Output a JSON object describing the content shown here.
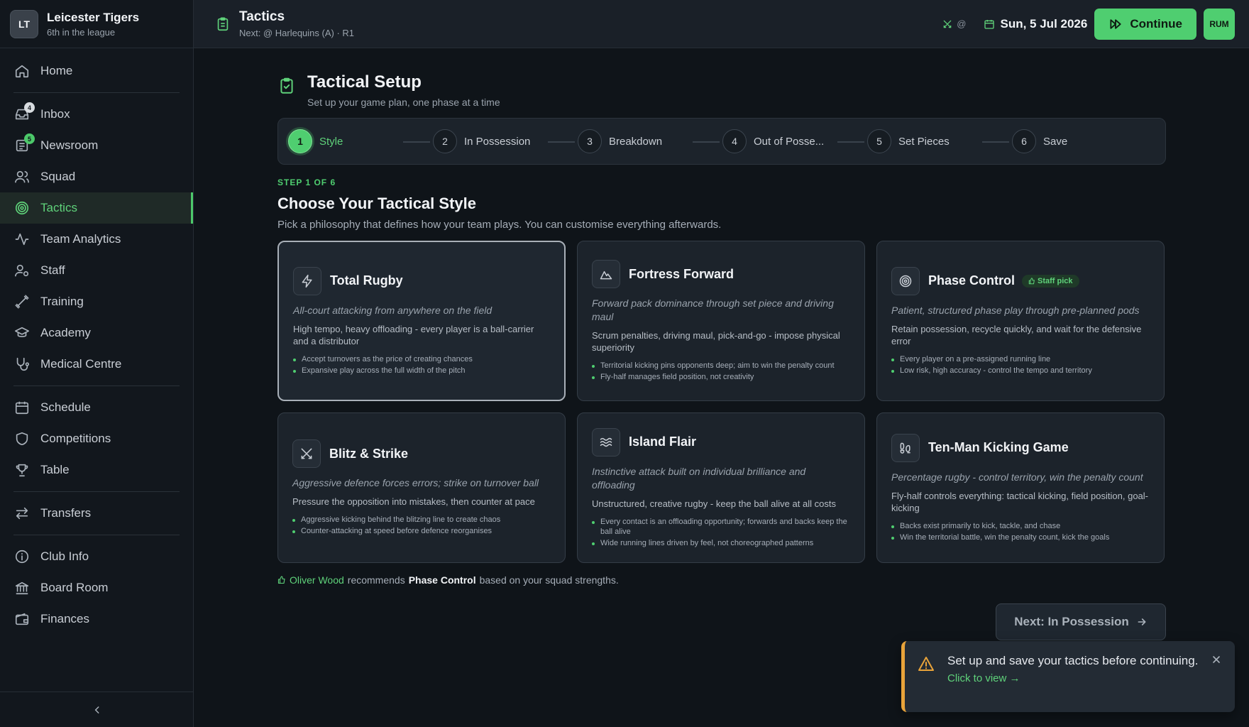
{
  "club": {
    "initials": "LT",
    "name": "Leicester Tigers",
    "position": "6th in the league"
  },
  "sidebar": {
    "items": [
      {
        "label": "Home",
        "icon": "home-icon"
      },
      {
        "label": "Inbox",
        "icon": "inbox-icon",
        "badge": "4"
      },
      {
        "label": "Newsroom",
        "icon": "newspaper-icon",
        "badge": "5"
      },
      {
        "label": "Squad",
        "icon": "users-icon"
      },
      {
        "label": "Tactics",
        "icon": "target-icon",
        "active": true
      },
      {
        "label": "Team Analytics",
        "icon": "activity-icon"
      },
      {
        "label": "Staff",
        "icon": "user-cog-icon"
      },
      {
        "label": "Training",
        "icon": "dumbbell-icon"
      },
      {
        "label": "Academy",
        "icon": "graduation-cap-icon"
      },
      {
        "label": "Medical Centre",
        "icon": "stethoscope-icon"
      },
      {
        "label": "Schedule",
        "icon": "calendar-icon"
      },
      {
        "label": "Competitions",
        "icon": "shield-icon"
      },
      {
        "label": "Table",
        "icon": "trophy-icon"
      },
      {
        "label": "Transfers",
        "icon": "arrows-icon"
      },
      {
        "label": "Club Info",
        "icon": "info-icon"
      },
      {
        "label": "Board Room",
        "icon": "bank-icon"
      },
      {
        "label": "Finances",
        "icon": "wallet-icon"
      }
    ]
  },
  "topbar": {
    "title": "Tactics",
    "subtitle": "Next: @ Harlequins (A) · R1",
    "status_at": "@",
    "date": "Sun, 5 Jul 2026",
    "continue_label": "Continue",
    "user_initials": "RUM"
  },
  "header": {
    "title": "Tactical Setup",
    "subtitle": "Set up your game plan, one phase at a time"
  },
  "steps": [
    {
      "num": "1",
      "label": "Style"
    },
    {
      "num": "2",
      "label": "In Possession"
    },
    {
      "num": "3",
      "label": "Breakdown"
    },
    {
      "num": "4",
      "label": "Out of Posse..."
    },
    {
      "num": "5",
      "label": "Set Pieces"
    },
    {
      "num": "6",
      "label": "Save"
    }
  ],
  "section": {
    "step_of": "STEP 1 OF 6",
    "title": "Choose Your Tactical Style",
    "subtitle": "Pick a philosophy that defines how your team plays. You can customise everything afterwards."
  },
  "styles": [
    {
      "title": "Total Rugby",
      "icon": "lightning-icon",
      "tagline": "All-court attacking from anywhere on the field",
      "description": "High tempo, heavy offloading - every player is a ball-carrier and a distributor",
      "points": [
        "Accept turnovers as the price of creating chances",
        "Expansive play across the full width of the pitch"
      ]
    },
    {
      "title": "Fortress Forward",
      "icon": "mountain-icon",
      "tagline": "Forward pack dominance through set piece and driving maul",
      "description": "Scrum penalties, driving maul, pick-and-go - impose physical superiority",
      "points": [
        "Territorial kicking pins opponents deep; aim to win the penalty count",
        "Fly-half manages field position, not creativity"
      ]
    },
    {
      "title": "Phase Control",
      "icon": "target-icon",
      "badge": "Staff pick",
      "tagline": "Patient, structured phase play through pre-planned pods",
      "description": "Retain possession, recycle quickly, and wait for the defensive error",
      "points": [
        "Every player on a pre-assigned running line",
        "Low risk, high accuracy - control the tempo and territory"
      ]
    },
    {
      "title": "Blitz & Strike",
      "icon": "swords-icon",
      "tagline": "Aggressive defence forces errors; strike on turnover ball",
      "description": "Pressure the opposition into mistakes, then counter at pace",
      "points": [
        "Aggressive kicking behind the blitzing line to create chaos",
        "Counter-attacking at speed before defence reorganises"
      ]
    },
    {
      "title": "Island Flair",
      "icon": "waves-icon",
      "tagline": "Instinctive attack built on individual brilliance and offloading",
      "description": "Unstructured, creative rugby - keep the ball alive at all costs",
      "points": [
        "Every contact is an offloading opportunity; forwards and backs keep the ball alive",
        "Wide running lines driven by feel, not choreographed patterns"
      ]
    },
    {
      "title": "Ten-Man Kicking Game",
      "icon": "footprints-icon",
      "tagline": "Percentage rugby - control territory, win the penalty count",
      "description": "Fly-half controls everything: tactical kicking, field position, goal-kicking",
      "points": [
        "Backs exist primarily to kick, tackle, and chase",
        "Win the territorial battle, win the penalty count, kick the goals"
      ]
    }
  ],
  "recommendation": {
    "coach": "Oliver Wood",
    "text1": "recommends",
    "style": "Phase Control",
    "text2": "based on your squad strengths."
  },
  "next_button": "Next: In Possession",
  "toast": {
    "message": "Set up and save your tactics before continuing.",
    "link": "Click to view →"
  },
  "colors": {
    "accent": "#4fce70",
    "warning": "#e8a33a",
    "background": "#0f1419"
  }
}
